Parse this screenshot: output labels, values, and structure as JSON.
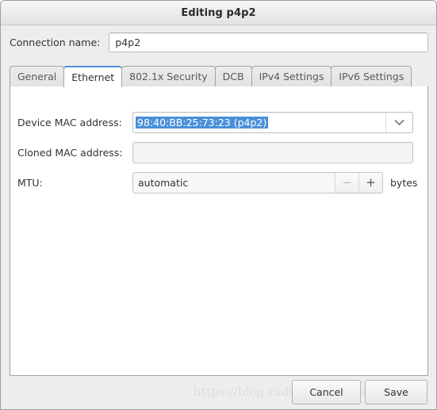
{
  "window": {
    "title": "Editing p4p2"
  },
  "connection": {
    "label": "Connection name:",
    "value": "p4p2",
    "placeholder": ""
  },
  "tabs": [
    {
      "label": "General",
      "active": false
    },
    {
      "label": "Ethernet",
      "active": true
    },
    {
      "label": "802.1x Security",
      "active": false
    },
    {
      "label": "DCB",
      "active": false
    },
    {
      "label": "IPv4 Settings",
      "active": false
    },
    {
      "label": "IPv6 Settings",
      "active": false
    }
  ],
  "ethernet": {
    "device_mac": {
      "label": "Device MAC address:",
      "value": "98:40:BB:25:73:23 (p4p2)",
      "selected": true,
      "dropdown_icon": "chevron-down-icon"
    },
    "cloned_mac": {
      "label": "Cloned MAC address:",
      "value": "",
      "placeholder": ""
    },
    "mtu": {
      "label": "MTU:",
      "value": "automatic",
      "units": "bytes",
      "decrement": "−",
      "increment": "+",
      "decrement_disabled": true
    }
  },
  "footer": {
    "watermark": "https://blog.csdn.net/aaaaaab_",
    "cancel_label": "Cancel",
    "save_label": "Save"
  },
  "colors": {
    "selection_blue": "#4a90d9",
    "window_bg": "#ededed",
    "panel_bg": "#ffffff",
    "text": "#2e3436"
  }
}
